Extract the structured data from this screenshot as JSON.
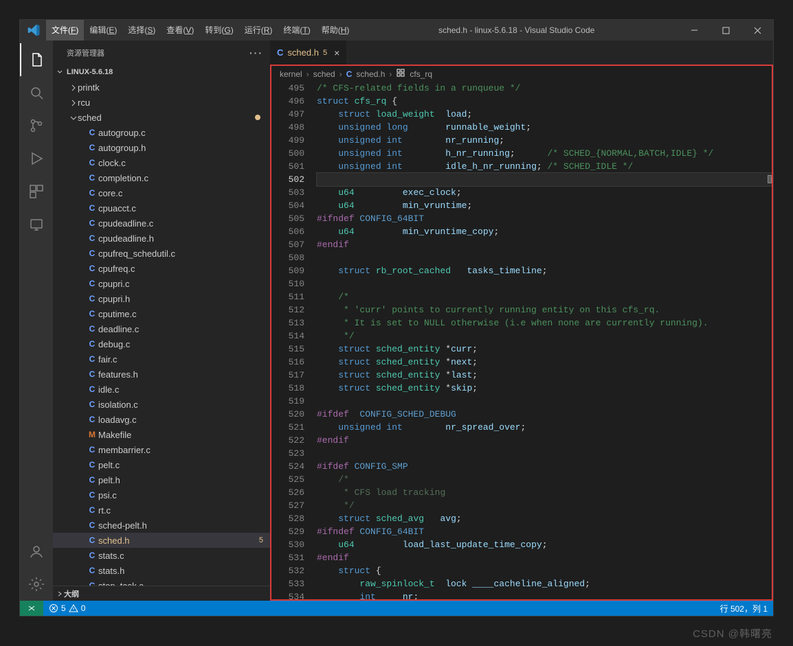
{
  "title": "sched.h - linux-5.6.18 - Visual Studio Code",
  "menu": [
    {
      "label": "文件",
      "hk": "F",
      "active": true
    },
    {
      "label": "编辑",
      "hk": "E"
    },
    {
      "label": "选择",
      "hk": "S"
    },
    {
      "label": "查看",
      "hk": "V"
    },
    {
      "label": "转到",
      "hk": "G"
    },
    {
      "label": "运行",
      "hk": "R"
    },
    {
      "label": "终端",
      "hk": "T"
    },
    {
      "label": "帮助",
      "hk": "H"
    }
  ],
  "sidebar": {
    "title": "资源管理器",
    "section": "LINUX-5.6.18",
    "outline": "大纲",
    "folders": [
      {
        "name": "printk",
        "state": "closed"
      },
      {
        "name": "rcu",
        "state": "closed"
      },
      {
        "name": "sched",
        "state": "open",
        "modified": true
      }
    ],
    "files": [
      {
        "icon": "C",
        "name": "autogroup.c"
      },
      {
        "icon": "C",
        "name": "autogroup.h"
      },
      {
        "icon": "C",
        "name": "clock.c"
      },
      {
        "icon": "C",
        "name": "completion.c"
      },
      {
        "icon": "C",
        "name": "core.c"
      },
      {
        "icon": "C",
        "name": "cpuacct.c"
      },
      {
        "icon": "C",
        "name": "cpudeadline.c"
      },
      {
        "icon": "C",
        "name": "cpudeadline.h"
      },
      {
        "icon": "C",
        "name": "cpufreq_schedutil.c"
      },
      {
        "icon": "C",
        "name": "cpufreq.c"
      },
      {
        "icon": "C",
        "name": "cpupri.c"
      },
      {
        "icon": "C",
        "name": "cpupri.h"
      },
      {
        "icon": "C",
        "name": "cputime.c"
      },
      {
        "icon": "C",
        "name": "deadline.c"
      },
      {
        "icon": "C",
        "name": "debug.c"
      },
      {
        "icon": "C",
        "name": "fair.c"
      },
      {
        "icon": "C",
        "name": "features.h"
      },
      {
        "icon": "C",
        "name": "idle.c"
      },
      {
        "icon": "C",
        "name": "isolation.c"
      },
      {
        "icon": "C",
        "name": "loadavg.c"
      },
      {
        "icon": "M",
        "name": "Makefile"
      },
      {
        "icon": "C",
        "name": "membarrier.c"
      },
      {
        "icon": "C",
        "name": "pelt.c"
      },
      {
        "icon": "C",
        "name": "pelt.h"
      },
      {
        "icon": "C",
        "name": "psi.c"
      },
      {
        "icon": "C",
        "name": "rt.c"
      },
      {
        "icon": "C",
        "name": "sched-pelt.h"
      },
      {
        "icon": "C",
        "name": "sched.h",
        "selected": true,
        "modified": true,
        "badge": "5"
      },
      {
        "icon": "C",
        "name": "stats.c"
      },
      {
        "icon": "C",
        "name": "stats.h"
      },
      {
        "icon": "C",
        "name": "stop_task.c"
      }
    ]
  },
  "tab": {
    "icon": "C",
    "label": "sched.h",
    "num": "5"
  },
  "breadcrumbs": [
    "kernel",
    "sched",
    "sched.h",
    "cfs_rq"
  ],
  "status": {
    "errors": "5",
    "warnings": "0",
    "ln": "行 502，列 1"
  },
  "watermark": "CSDN @韩曙亮",
  "code": {
    "start": 495,
    "cursor": 502,
    "lines": [
      [
        [
          "cmt",
          "/* CFS-related fields in a runqueue */"
        ]
      ],
      [
        [
          "kw",
          "struct"
        ],
        [
          "op",
          " "
        ],
        [
          "type",
          "cfs_rq"
        ],
        [
          "op",
          " {"
        ]
      ],
      [
        [
          "op",
          "    "
        ],
        [
          "kw",
          "struct"
        ],
        [
          "op",
          " "
        ],
        [
          "type",
          "load_weight"
        ],
        [
          "op",
          "  "
        ],
        [
          "id",
          "load"
        ],
        [
          "op",
          ";"
        ]
      ],
      [
        [
          "op",
          "    "
        ],
        [
          "kw",
          "unsigned long"
        ],
        [
          "op",
          "       "
        ],
        [
          "id",
          "runnable_weight"
        ],
        [
          "op",
          ";"
        ]
      ],
      [
        [
          "op",
          "    "
        ],
        [
          "kw",
          "unsigned int"
        ],
        [
          "op",
          "        "
        ],
        [
          "id",
          "nr_running"
        ],
        [
          "op",
          ";"
        ]
      ],
      [
        [
          "op",
          "    "
        ],
        [
          "kw",
          "unsigned int"
        ],
        [
          "op",
          "        "
        ],
        [
          "id",
          "h_nr_running"
        ],
        [
          "op",
          ";      "
        ],
        [
          "cmt",
          "/* SCHED_{NORMAL,BATCH,IDLE} */"
        ]
      ],
      [
        [
          "op",
          "    "
        ],
        [
          "kw",
          "unsigned int"
        ],
        [
          "op",
          "        "
        ],
        [
          "id",
          "idle_h_nr_running"
        ],
        [
          "op",
          "; "
        ],
        [
          "cmt",
          "/* SCHED_IDLE */"
        ]
      ],
      [],
      [
        [
          "op",
          "    "
        ],
        [
          "type",
          "u64"
        ],
        [
          "op",
          "         "
        ],
        [
          "id",
          "exec_clock"
        ],
        [
          "op",
          ";"
        ]
      ],
      [
        [
          "op",
          "    "
        ],
        [
          "type",
          "u64"
        ],
        [
          "op",
          "         "
        ],
        [
          "id",
          "min_vruntime"
        ],
        [
          "op",
          ";"
        ]
      ],
      [
        [
          "pp",
          "#ifndef"
        ],
        [
          "op",
          " "
        ],
        [
          "mac",
          "CONFIG_64BIT"
        ]
      ],
      [
        [
          "op",
          "    "
        ],
        [
          "type",
          "u64"
        ],
        [
          "op",
          "         "
        ],
        [
          "id",
          "min_vruntime_copy"
        ],
        [
          "op",
          ";"
        ]
      ],
      [
        [
          "pp",
          "#endif"
        ]
      ],
      [],
      [
        [
          "op",
          "    "
        ],
        [
          "kw",
          "struct"
        ],
        [
          "op",
          " "
        ],
        [
          "type",
          "rb_root_cached"
        ],
        [
          "op",
          "   "
        ],
        [
          "id",
          "tasks_timeline"
        ],
        [
          "op",
          ";"
        ]
      ],
      [],
      [
        [
          "op",
          "    "
        ],
        [
          "cmt",
          "/*"
        ]
      ],
      [
        [
          "op",
          "     "
        ],
        [
          "cmt",
          "* 'curr' points to currently running entity on this cfs_rq."
        ]
      ],
      [
        [
          "op",
          "     "
        ],
        [
          "cmt",
          "* It is set to NULL otherwise (i.e when none are currently running)."
        ]
      ],
      [
        [
          "op",
          "     "
        ],
        [
          "cmt",
          "*/"
        ]
      ],
      [
        [
          "op",
          "    "
        ],
        [
          "kw",
          "struct"
        ],
        [
          "op",
          " "
        ],
        [
          "type",
          "sched_entity"
        ],
        [
          "op",
          " *"
        ],
        [
          "id",
          "curr"
        ],
        [
          "op",
          ";"
        ]
      ],
      [
        [
          "op",
          "    "
        ],
        [
          "kw",
          "struct"
        ],
        [
          "op",
          " "
        ],
        [
          "type",
          "sched_entity"
        ],
        [
          "op",
          " *"
        ],
        [
          "id",
          "next"
        ],
        [
          "op",
          ";"
        ]
      ],
      [
        [
          "op",
          "    "
        ],
        [
          "kw",
          "struct"
        ],
        [
          "op",
          " "
        ],
        [
          "type",
          "sched_entity"
        ],
        [
          "op",
          " *"
        ],
        [
          "id",
          "last"
        ],
        [
          "op",
          ";"
        ]
      ],
      [
        [
          "op",
          "    "
        ],
        [
          "kw",
          "struct"
        ],
        [
          "op",
          " "
        ],
        [
          "type",
          "sched_entity"
        ],
        [
          "op",
          " *"
        ],
        [
          "id",
          "skip"
        ],
        [
          "op",
          ";"
        ]
      ],
      [],
      [
        [
          "pp",
          "#ifdef"
        ],
        [
          "op",
          "  "
        ],
        [
          "mac",
          "CONFIG_SCHED_DEBUG"
        ]
      ],
      [
        [
          "op",
          "    "
        ],
        [
          "kw",
          "unsigned int"
        ],
        [
          "op",
          "        "
        ],
        [
          "id",
          "nr_spread_over"
        ],
        [
          "op",
          ";"
        ]
      ],
      [
        [
          "pp",
          "#endif"
        ]
      ],
      [],
      [
        [
          "pp",
          "#ifdef"
        ],
        [
          "op",
          " "
        ],
        [
          "mac",
          "CONFIG_SMP"
        ]
      ],
      [
        [
          "op",
          "    "
        ],
        [
          "cmt2",
          "/*"
        ]
      ],
      [
        [
          "op",
          "     "
        ],
        [
          "cmt2",
          "* CFS load tracking"
        ]
      ],
      [
        [
          "op",
          "     "
        ],
        [
          "cmt2",
          "*/"
        ]
      ],
      [
        [
          "op",
          "    "
        ],
        [
          "kw",
          "struct"
        ],
        [
          "op",
          " "
        ],
        [
          "type",
          "sched_avg"
        ],
        [
          "op",
          "   "
        ],
        [
          "id",
          "avg"
        ],
        [
          "op",
          ";"
        ]
      ],
      [
        [
          "pp",
          "#ifndef"
        ],
        [
          "op",
          " "
        ],
        [
          "mac",
          "CONFIG_64BIT"
        ]
      ],
      [
        [
          "op",
          "    "
        ],
        [
          "type",
          "u64"
        ],
        [
          "op",
          "         "
        ],
        [
          "id",
          "load_last_update_time_copy"
        ],
        [
          "op",
          ";"
        ]
      ],
      [
        [
          "pp",
          "#endif"
        ]
      ],
      [
        [
          "op",
          "    "
        ],
        [
          "kw",
          "struct"
        ],
        [
          "op",
          " {"
        ]
      ],
      [
        [
          "op",
          "        "
        ],
        [
          "type",
          "raw_spinlock_t"
        ],
        [
          "op",
          "  "
        ],
        [
          "id",
          "lock"
        ],
        [
          "op",
          " "
        ],
        [
          "id",
          "____cacheline_aligned"
        ],
        [
          "op",
          ";"
        ]
      ],
      [
        [
          "op",
          "        "
        ],
        [
          "kw",
          "int"
        ],
        [
          "op",
          "     "
        ],
        [
          "id",
          "nr"
        ],
        [
          "op",
          ";"
        ]
      ]
    ]
  }
}
